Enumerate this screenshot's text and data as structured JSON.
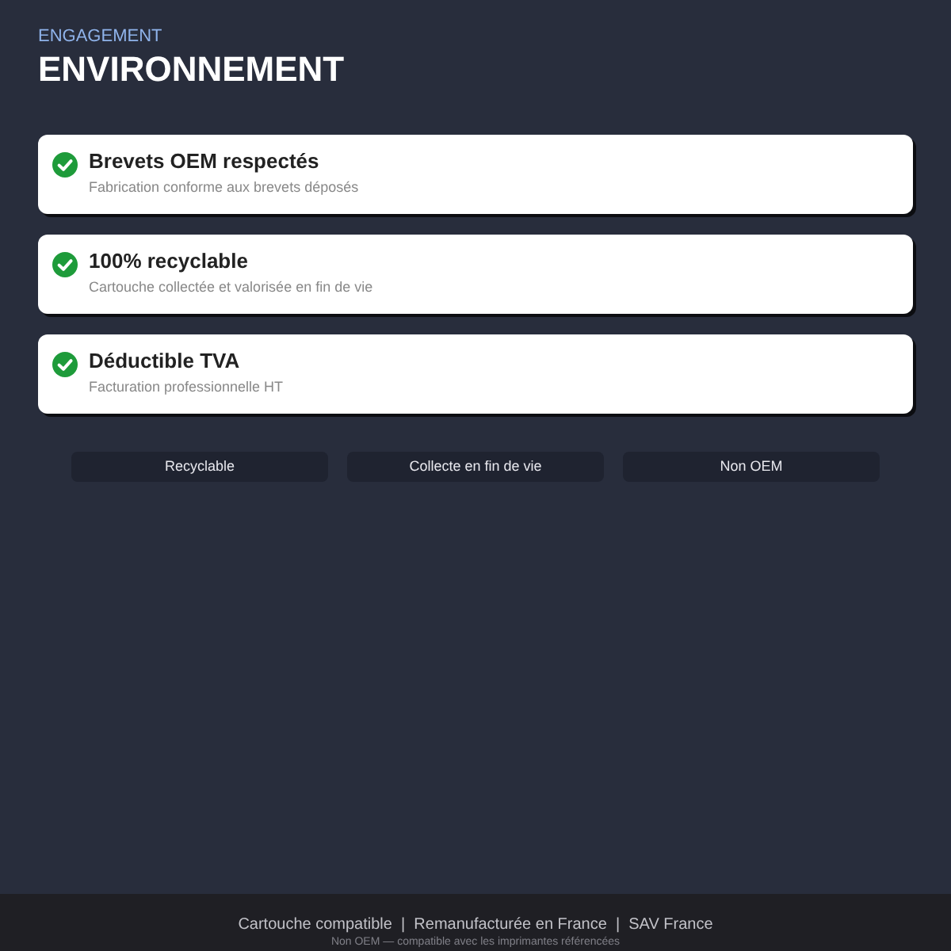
{
  "header": {
    "eyebrow": "ENGAGEMENT",
    "title": "ENVIRONNEMENT"
  },
  "features": [
    {
      "title": "Brevets OEM respectés",
      "description": "Fabrication conforme aux brevets déposés"
    },
    {
      "title": "100% recyclable",
      "description": "Cartouche collectée et valorisée en fin de vie"
    },
    {
      "title": "Déductible TVA",
      "description": "Facturation professionnelle HT"
    }
  ],
  "tags": [
    "Recyclable",
    "Collecte en fin de vie",
    "Non OEM"
  ],
  "footer": {
    "links": "Cartouche compatible  |  Remanufacturée en France  |  SAV France",
    "note": "Non OEM — compatible avec les imprimantes référencées"
  }
}
